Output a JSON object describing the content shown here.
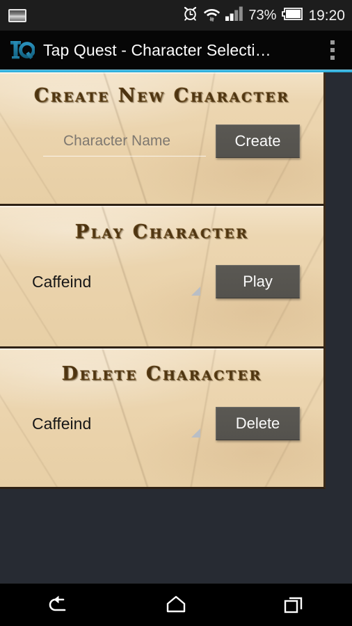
{
  "status_bar": {
    "screenshot_icon": "screenshot-icon",
    "alarm_icon": "alarm-clock-icon",
    "wifi_icon": "wifi-icon",
    "signal_icon": "signal-bars-icon",
    "battery_percent": "73%",
    "battery_icon": "battery-icon",
    "time": "19:20"
  },
  "app_bar": {
    "logo": "TQ",
    "title": "Tap Quest - Character Selecti…",
    "overflow_icon": "overflow-menu-icon",
    "accent_color": "#31b0dd"
  },
  "panels": [
    {
      "id": "create",
      "title": "Create New Character",
      "input": {
        "value": "",
        "placeholder": "Character Name"
      },
      "button": "Create"
    },
    {
      "id": "play",
      "title": "Play Character",
      "spinner": {
        "selected": "Caffeind",
        "caret_icon": "spinner-caret-icon"
      },
      "button": "Play"
    },
    {
      "id": "delete",
      "title": "Delete Character",
      "spinner": {
        "selected": "Caffeind",
        "caret_icon": "spinner-caret-icon"
      },
      "button": "Delete"
    }
  ],
  "nav_bar": {
    "back": "back-icon",
    "home": "home-icon",
    "recents": "recents-icon"
  },
  "theme": {
    "background": "#272b33",
    "parchment": "#ecd6b1",
    "title_brown": "#4c3210",
    "button_gray": "#55534e"
  }
}
